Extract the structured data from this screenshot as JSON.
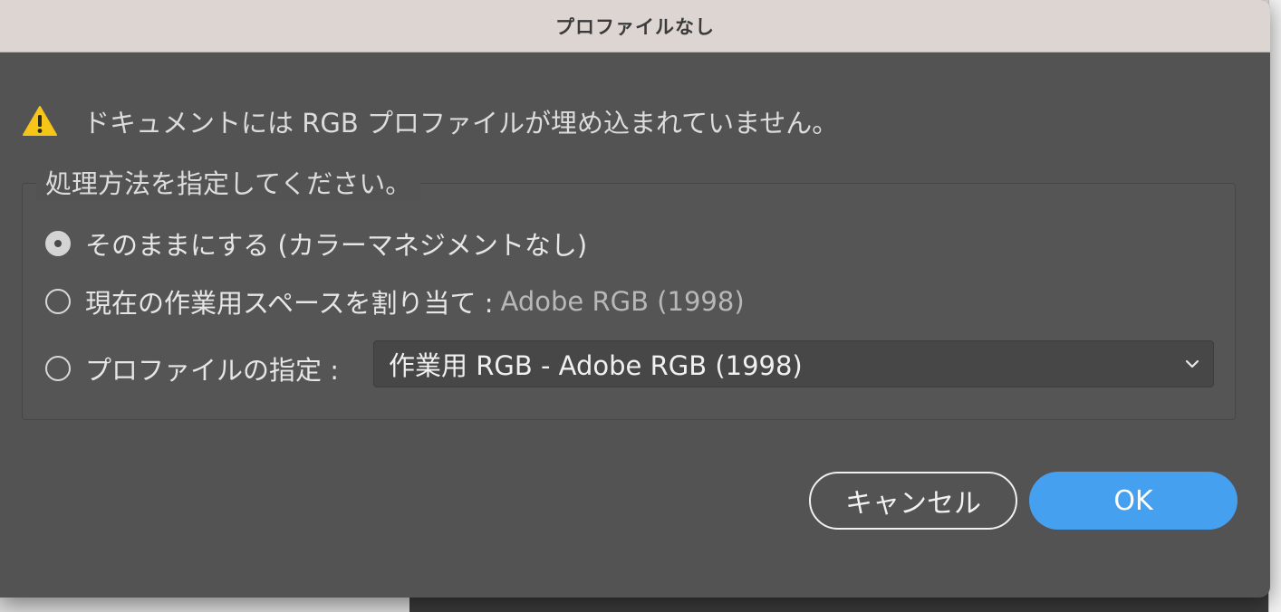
{
  "dialog": {
    "title": "プロファイルなし",
    "warning_message": "ドキュメントには RGB プロファイルが埋め込まれていません。",
    "warning_icon": "warning-triangle-icon",
    "group_label": "処理方法を指定してください。",
    "options": [
      {
        "label": "そのままにする (カラーマネジメントなし)",
        "checked": true
      },
      {
        "label": "現在の作業用スペースを割り当て :",
        "value": "Adobe RGB (1998)",
        "checked": false
      },
      {
        "label": "プロファイルの指定 :",
        "checked": false
      }
    ],
    "profile_select": {
      "selected": "作業用 RGB - Adobe RGB (1998)",
      "icon": "chevron-down-icon"
    },
    "buttons": {
      "cancel": "キャンセル",
      "ok": "OK"
    },
    "colors": {
      "dialog_bg": "#535353",
      "titlebar_bg": "#ddd5d2",
      "primary_button": "#46a0f0",
      "warning_yellow": "#f5c518"
    }
  }
}
